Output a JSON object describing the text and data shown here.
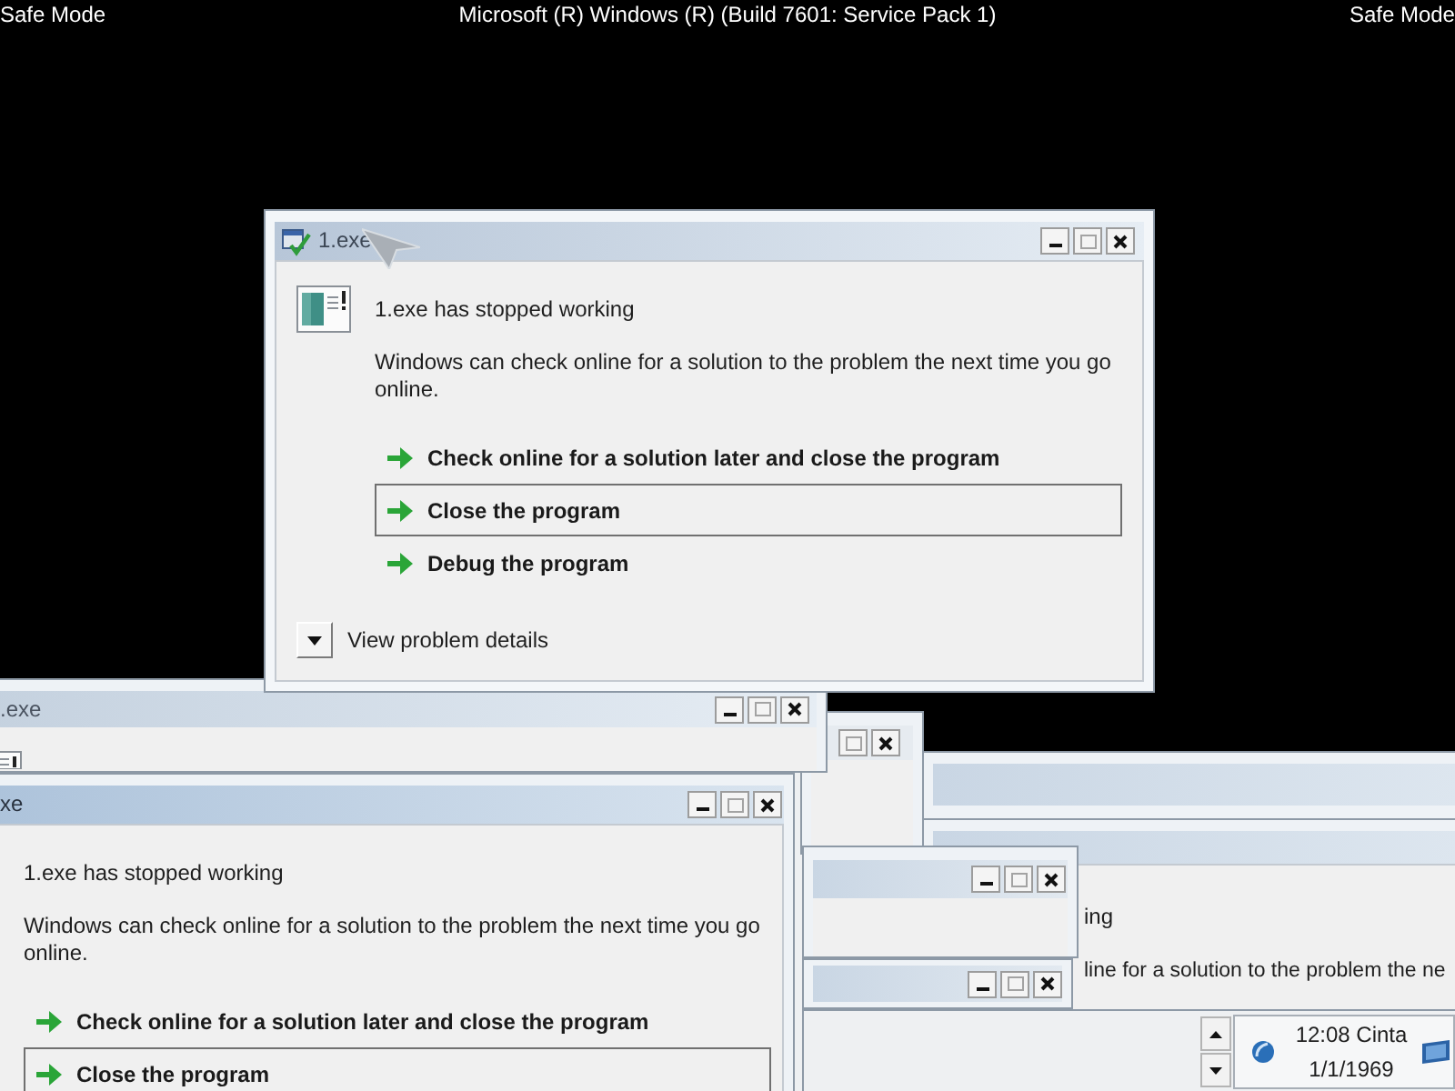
{
  "header": {
    "left_label": "Safe Mode",
    "center_label": "Microsoft (R) Windows (R) (Build 7601: Service Pack 1)",
    "right_label": "Safe Mode"
  },
  "error_dialog": {
    "title": "1.exe",
    "heading": "1.exe has stopped working",
    "message": "Windows can check online for a solution to the problem the next time you go online.",
    "options": [
      {
        "label": "Check online for a solution later and close the program",
        "selected": false
      },
      {
        "label": "Close the program",
        "selected": true
      },
      {
        "label": "Debug the program",
        "selected": false
      }
    ],
    "details_toggle": {
      "label": "View problem details",
      "expanded": false
    }
  },
  "rear_dialog": {
    "title": ".exe"
  },
  "front_dialog": {
    "title": "xe",
    "heading": "1.exe has stopped working",
    "message": "Windows can check online for a solution to the problem the next time you go online.",
    "options": [
      {
        "label": "Check online for a solution later and close the program",
        "selected": false
      },
      {
        "label": "Close the program",
        "selected": true
      }
    ]
  },
  "right_dialog": {
    "heading": "ing",
    "message": "line for a solution to the problem the ne"
  },
  "taskbar": {
    "clock_time": "12:08 Cinta",
    "clock_date": "1/1/1969"
  }
}
